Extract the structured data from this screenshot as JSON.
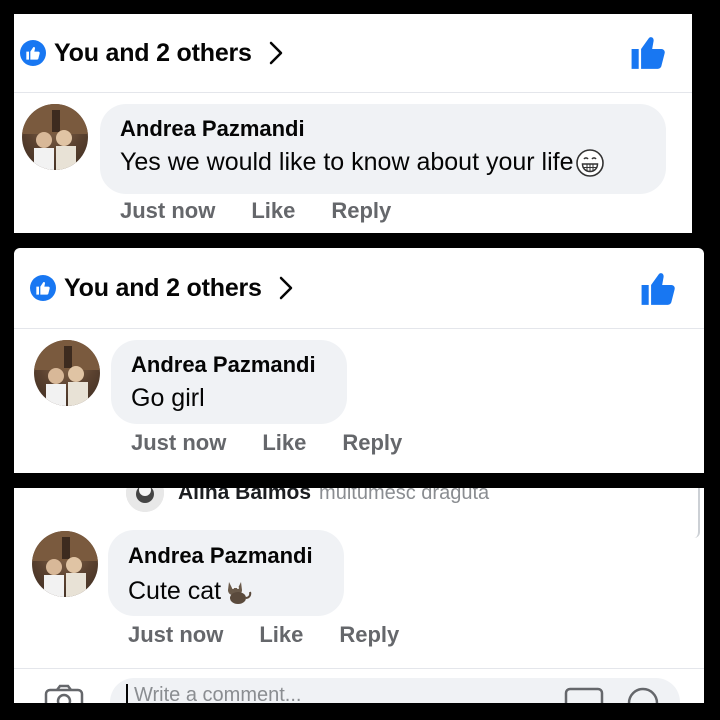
{
  "panels": [
    {
      "reactions": {
        "text": "You and 2 others",
        "like_icon": "like-icon",
        "chevron_icon": "chevron-right-icon"
      },
      "comment": {
        "author": "Andrea Pazmandi",
        "message": "Yes we would like to know about your life",
        "emoji": "grinning-face-emoji"
      },
      "actions": {
        "time": "Just now",
        "like": "Like",
        "reply": "Reply"
      }
    },
    {
      "reactions": {
        "text": "You and 2 others",
        "like_icon": "like-icon",
        "chevron_icon": "chevron-right-icon"
      },
      "comment": {
        "author": "Andrea Pazmandi",
        "message": "Go girl"
      },
      "actions": {
        "time": "Just now",
        "like": "Like",
        "reply": "Reply"
      }
    },
    {
      "previous_comment": {
        "author": "Alina Balmos",
        "message": "multumesc draguta"
      },
      "comment": {
        "author": "Andrea Pazmandi",
        "message": "Cute cat",
        "emoji": "cat-emoji"
      },
      "actions": {
        "time": "Just now",
        "like": "Like",
        "reply": "Reply"
      },
      "composer": {
        "placeholder": "Write a comment...",
        "camera_icon": "camera-icon",
        "gif_icon": "gif-icon",
        "emoji_icon": "smiley-icon"
      }
    }
  ],
  "colors": {
    "accent": "#1877f2",
    "bubble": "#f0f2f5",
    "secondary_text": "#65676b"
  }
}
